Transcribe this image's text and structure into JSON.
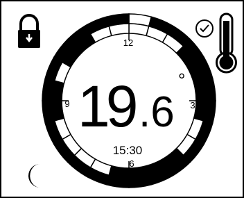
{
  "display": {
    "temperature_int": "19",
    "temperature_dec": ".6",
    "degree_symbol": "°",
    "time": "15:30"
  },
  "dial": {
    "hour_labels": {
      "h12": "12",
      "h3": "3",
      "h6": "6",
      "h9": "9"
    },
    "segments": 24,
    "outer_filled": [
      1,
      2,
      3,
      4,
      5,
      6,
      7,
      8,
      9,
      10,
      11,
      12,
      13,
      14,
      15,
      16,
      17,
      18,
      19,
      20,
      21,
      22,
      23
    ],
    "inner_filled": [
      3,
      4,
      5,
      6,
      9,
      10,
      11,
      12,
      17,
      18,
      20,
      21
    ]
  },
  "icons": {
    "lock": "lock-icon",
    "clock": "clock-icon",
    "thermometer": "thermometer-icon",
    "moon": "moon-icon"
  },
  "colors": {
    "ink": "#000000",
    "background": "#ffffff"
  }
}
